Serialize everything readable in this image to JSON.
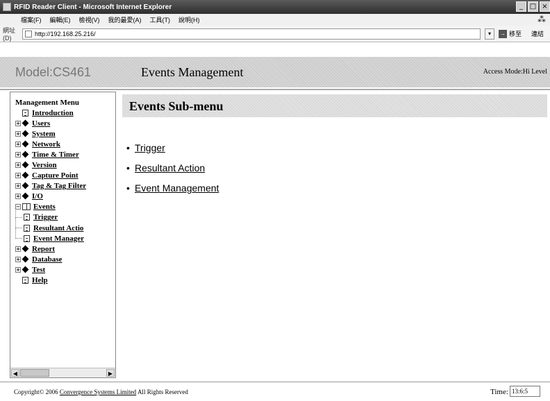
{
  "window": {
    "title": "RFID Reader Client - Microsoft Internet Explorer",
    "controls": [
      "_",
      "□",
      "×"
    ]
  },
  "menubar": {
    "items": [
      "檔案(F)",
      "編輯(E)",
      "檢視(V)",
      "我的最愛(A)",
      "工具(T)",
      "說明(H)"
    ],
    "right_glyph": "⁂"
  },
  "addressbar": {
    "label": "網址(D)",
    "url": "http://192.168.25.216/",
    "go_label": "移至",
    "links_label": "連結"
  },
  "header": {
    "model": "Model:CS461",
    "page_title": "Events Management",
    "access_mode": "Access Mode:Hi Level"
  },
  "sidebar": {
    "title": "Management Menu",
    "items": [
      {
        "label": "Introduction",
        "icon": "doc-icon",
        "expander": "",
        "child": false
      },
      {
        "label": "Users",
        "icon": "diamond-icon",
        "expander": "+",
        "child": false
      },
      {
        "label": "System",
        "icon": "diamond-icon",
        "expander": "+",
        "child": false
      },
      {
        "label": "Network",
        "icon": "diamond-icon",
        "expander": "+",
        "child": false
      },
      {
        "label": "Time & Timer",
        "icon": "diamond-icon",
        "expander": "+",
        "child": false
      },
      {
        "label": "Version",
        "icon": "diamond-icon",
        "expander": "+",
        "child": false
      },
      {
        "label": "Capture Point",
        "icon": "diamond-icon",
        "expander": "+",
        "child": false
      },
      {
        "label": "Tag & Tag Filter",
        "icon": "diamond-icon",
        "expander": "+",
        "child": false
      },
      {
        "label": "I/O",
        "icon": "diamond-icon",
        "expander": "+",
        "child": false
      },
      {
        "label": "Events",
        "icon": "book-icon",
        "expander": "−",
        "child": false
      },
      {
        "label": "Trigger",
        "icon": "doc-icon",
        "expander": "",
        "child": true
      },
      {
        "label": "Resultant Actio",
        "icon": "doc-icon",
        "expander": "",
        "child": true
      },
      {
        "label": "Event Manager",
        "icon": "doc-icon",
        "expander": "",
        "child": true
      },
      {
        "label": "Report",
        "icon": "diamond-icon",
        "expander": "+",
        "child": false
      },
      {
        "label": "Database",
        "icon": "diamond-icon",
        "expander": "+",
        "child": false
      },
      {
        "label": "Test",
        "icon": "diamond-icon",
        "expander": "+",
        "child": false
      },
      {
        "label": "Help",
        "icon": "doc-icon",
        "expander": "",
        "child": false
      }
    ]
  },
  "content": {
    "submenu_title": "Events  Sub-menu",
    "links": [
      "Trigger",
      "Resultant  Action",
      "Event  Management"
    ]
  },
  "footer": {
    "copyright_prefix": "Copyright© 2006",
    "company": "Convergence Systems Limited",
    "copyright_suffix": "All Rights Reserved",
    "time_label": "Time:",
    "time_value": "13:6:5"
  }
}
